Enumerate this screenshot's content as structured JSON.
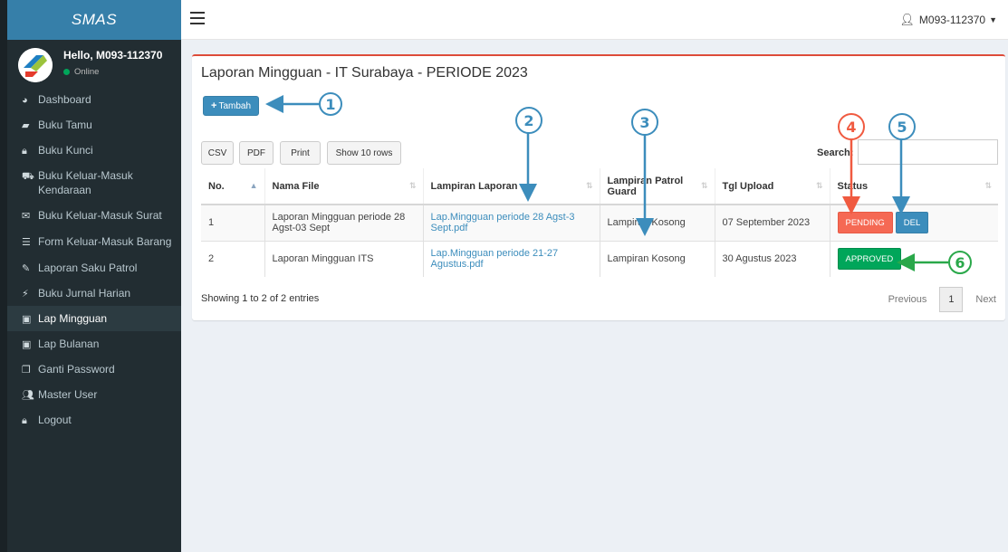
{
  "brand": "SMAS",
  "user": {
    "greeting": "Hello, M093-112370",
    "status": "Online"
  },
  "menu": [
    {
      "label": "Dashboard",
      "icon": "dashboard-icon"
    },
    {
      "label": "Buku Tamu",
      "icon": "book-icon"
    },
    {
      "label": "Buku Kunci",
      "icon": "lock-icon"
    },
    {
      "label": "Buku Keluar-Masuk Kendaraan",
      "icon": "truck-icon"
    },
    {
      "label": "Buku Keluar-Masuk Surat",
      "icon": "envelope-icon"
    },
    {
      "label": "Form Keluar-Masuk Barang",
      "icon": "list-icon"
    },
    {
      "label": "Laporan Saku Patrol",
      "icon": "paperclip-icon"
    },
    {
      "label": "Buku Jurnal Harian",
      "icon": "magic-icon"
    },
    {
      "label": "Lap Mingguan",
      "icon": "money-icon"
    },
    {
      "label": "Lap Bulanan",
      "icon": "money-icon"
    },
    {
      "label": "Ganti Password",
      "icon": "copy-icon"
    },
    {
      "label": "Master User",
      "icon": "users-icon"
    },
    {
      "label": "Logout",
      "icon": "lock-icon"
    }
  ],
  "header": {
    "user_label": "M093-112370"
  },
  "box": {
    "title": "Laporan Mingguan - IT Surabaya - PERIODE 2023",
    "add_label": "Tambah",
    "csv": "CSV",
    "pdf": "PDF",
    "print": "Print",
    "show_rows": "Show 10 rows",
    "search_label": "Search:"
  },
  "table": {
    "headers": [
      "No.",
      "Nama File",
      "Lampiran Laporan",
      "Lampiran Patrol Guard",
      "Tgl Upload",
      "Status"
    ],
    "rows": [
      {
        "no": "1",
        "nama": "Laporan Mingguan periode 28 Agst-03 Sept",
        "lampiran": "Lap.Mingguan periode 28 Agst-3 Sept.pdf",
        "patrol": "Lampiran Kosong",
        "tgl": "07 September 2023",
        "status": "PENDING",
        "del": "DEL"
      },
      {
        "no": "2",
        "nama": "Laporan Mingguan ITS",
        "lampiran": "Lap.Mingguan periode 21-27 Agustus.pdf",
        "patrol": "Lampiran Kosong",
        "tgl": "30 Agustus 2023",
        "status": "APPROVED"
      }
    ]
  },
  "footer": {
    "info": "Showing 1 to 2 of 2 entries",
    "previous": "Previous",
    "page": "1",
    "next": "Next"
  },
  "annotations": [
    "1",
    "2",
    "3",
    "4",
    "5",
    "6"
  ],
  "colors": {
    "accent": "#3c8dbc",
    "sidebar": "#222d32",
    "annotation_blue": "#3c8dbc",
    "annotation_red": "#f05a40",
    "annotation_green": "#2aa84a",
    "pending": "#f56954",
    "approved": "#00a65a"
  }
}
